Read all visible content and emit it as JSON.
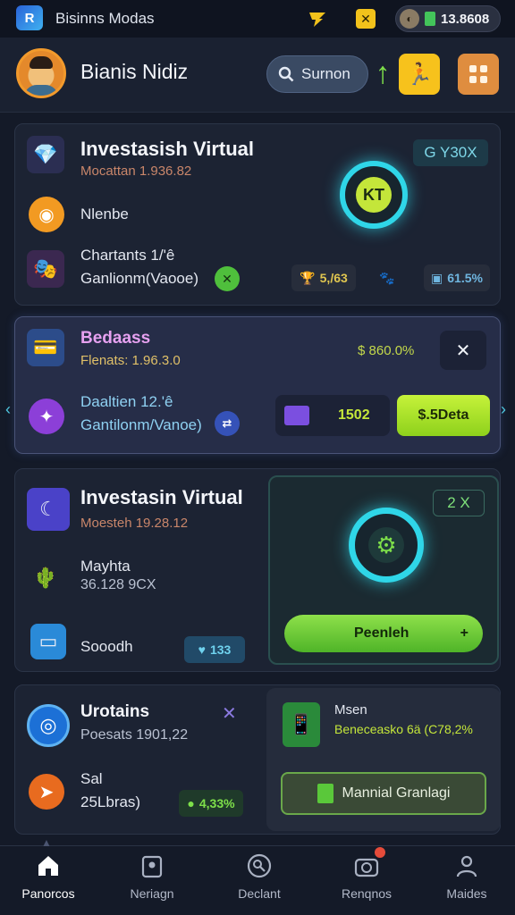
{
  "status_bar": {
    "app_logo_text": "R",
    "title": "Bisinns Modas",
    "balance": "13.8608",
    "icons": [
      "lightning-icon",
      "box-icon",
      "coin-icon"
    ]
  },
  "header": {
    "title": "Bianis Nidiz",
    "search_label": "Surnon",
    "icons": [
      "avatar",
      "search-icon",
      "arrow-up-icon",
      "running-icon",
      "grid-icon"
    ]
  },
  "card1": {
    "title": "Investasish Virtual",
    "subtitle": "Mocattan 1.936.82",
    "badge": "G Y30X",
    "row1_label": "Nlenbe",
    "row2_title": "Chartants 1/'ê",
    "row2_subtitle": "Ganlionm(Vaooe)",
    "chip1": "5,/63",
    "chip2": "61.5%",
    "ring_label": "KT"
  },
  "card2": {
    "title": "Bedaass",
    "subtitle": "Flenats: 1.96.3.0",
    "value": "$ 860.0%",
    "row_title": "Daaltien 12.'ê",
    "row_subtitle": "Gantilonm/Vanoe)",
    "percent": "1502",
    "action_label": "$.5Deta"
  },
  "card3": {
    "title": "Investasin Virtual",
    "subtitle": "Moesteh 19.28.12",
    "row1_title": "Mayhta",
    "row1_subtitle": "36.128 9CX",
    "row2_label": "Sooodh",
    "chip": "133",
    "badge": "2 X",
    "action_label": "Peenleh"
  },
  "card4": {
    "title": "Urotains",
    "subtitle": "Poesats 1901,22",
    "row_title": "Sal",
    "row_subtitle": "25Lbras)",
    "chip": "4,33%",
    "right_title": "Msen",
    "right_subtitle": "Beneceasko 6ä (C78,2%",
    "action_label": "Mannial Granlagi"
  },
  "bottom_nav": [
    {
      "label": "Panorcos",
      "icon": "home-icon",
      "active": true
    },
    {
      "label": "Neriagn",
      "icon": "badge-icon",
      "active": false
    },
    {
      "label": "Declant",
      "icon": "search-circle-icon",
      "active": false
    },
    {
      "label": "Renqnos",
      "icon": "camera-icon",
      "active": false
    },
    {
      "label": "Maides",
      "icon": "user-icon",
      "active": false
    }
  ],
  "colors": {
    "accent_green": "#a6e22e",
    "accent_cyan": "#2fd6e8",
    "card_bg": "#1c2333"
  }
}
